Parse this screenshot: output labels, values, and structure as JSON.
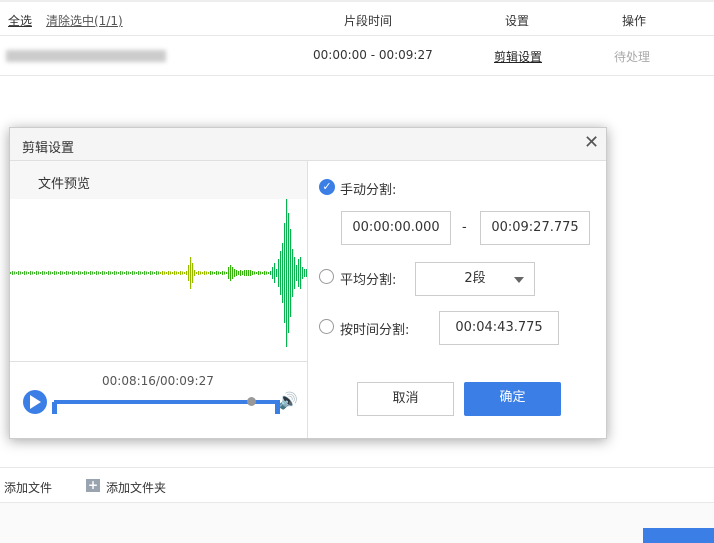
{
  "table": {
    "select_all": "全选",
    "clear_selection": "清除选中(1/1)",
    "col_time": "片段时间",
    "col_settings": "设置",
    "col_action": "操作",
    "rows": [
      {
        "time": "00:00:00 - 00:09:27",
        "settings": "剪辑设置",
        "action": "待处理"
      }
    ]
  },
  "dialog": {
    "title": "剪辑设置",
    "preview_label": "文件预览",
    "playback_time": "00:08:16/00:09:27",
    "playback_progress": 0.87,
    "manual_label": "手动分割:",
    "manual_start": "00:00:00.000",
    "separator": "-",
    "manual_end": "00:09:27.775",
    "average_label": "平均分割:",
    "average_value": "2段",
    "bytime_label": "按时间分割:",
    "bytime_value": "00:04:43.775",
    "cancel": "取消",
    "confirm": "确定"
  },
  "footer": {
    "add_file": "添加文件",
    "add_folder": "添加文件夹"
  },
  "colors": {
    "accent": "#3a7ee6"
  }
}
